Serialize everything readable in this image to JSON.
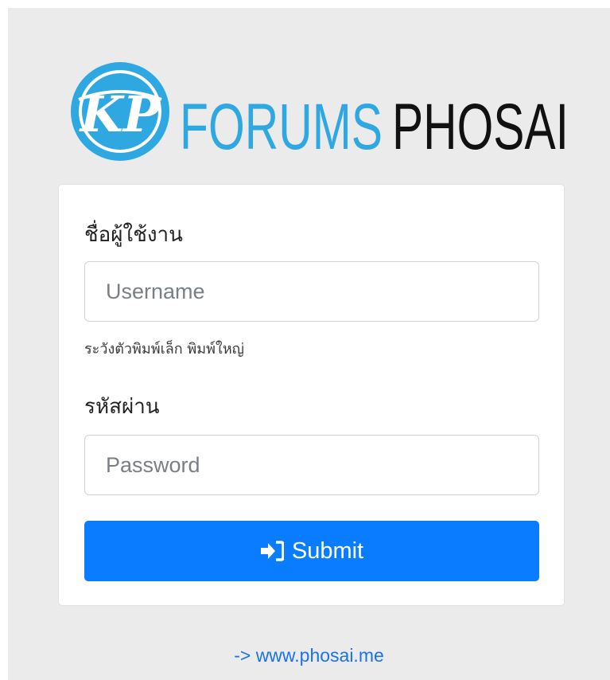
{
  "logo": {
    "monogram": "KP",
    "word1": "FORUMS",
    "word2": "PHOSAI",
    "brand_color": "#2fa8e2",
    "dark_color": "#111111"
  },
  "login": {
    "username_label": "ชื่อผู้ใช้งาน",
    "username_placeholder": "Username",
    "username_hint": "ระวังตัวพิมพ์เล็ก พิมพ์ใหญ่",
    "password_label": "รหัสผ่าน",
    "password_placeholder": "Password",
    "submit_label": "Submit",
    "submit_icon": "sign-in-icon",
    "submit_color": "#0a7cff"
  },
  "footer": {
    "link_text": "-> www.phosai.me"
  }
}
